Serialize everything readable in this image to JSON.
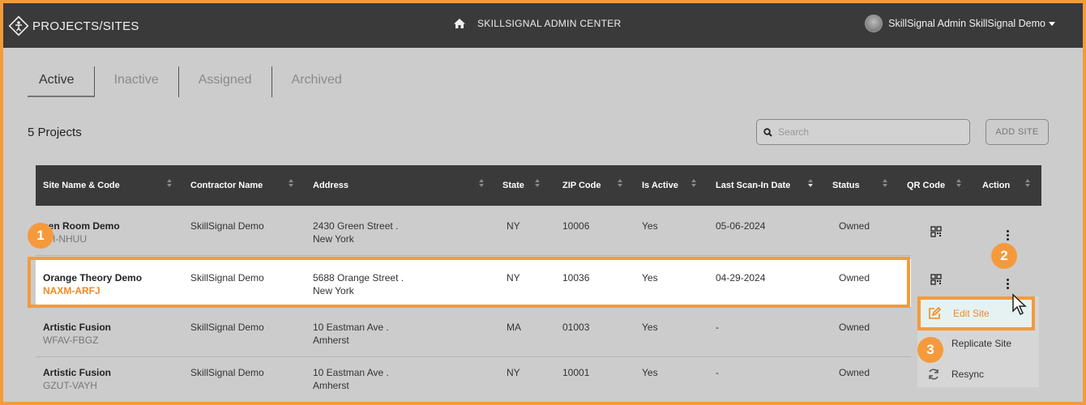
{
  "header": {
    "brand": "PROJECTS/SITES",
    "center_title": "SKILLSIGNAL ADMIN CENTER",
    "user_name": "SkillSignal Admin SkillSignal Demo"
  },
  "tabs": [
    {
      "label": "Active",
      "active": true
    },
    {
      "label": "Inactive",
      "active": false
    },
    {
      "label": "Assigned",
      "active": false
    },
    {
      "label": "Archived",
      "active": false
    }
  ],
  "project_count": "5 Projects",
  "search": {
    "placeholder": "Search"
  },
  "add_site_label": "ADD SITE",
  "columns": [
    "Site Name & Code",
    "Contractor Name",
    "Address",
    "State",
    "ZIP Code",
    "Is Active",
    "Last Scan-In Date",
    "Status",
    "QR Code",
    "Action"
  ],
  "rows": [
    {
      "name": "een Room Demo",
      "code": "7H-NHUU",
      "contractor": "SkillSignal Demo",
      "address1": "2430 Green Street .",
      "address2": "New York",
      "state": "NY",
      "zip": "10006",
      "active": "Yes",
      "last_scan": "05-06-2024",
      "status": "Owned"
    },
    {
      "name": "Orange Theory Demo",
      "code": "NAXM-ARFJ",
      "contractor": "SkillSignal Demo",
      "address1": "5688 Orange Street .",
      "address2": "New York",
      "state": "NY",
      "zip": "10036",
      "active": "Yes",
      "last_scan": "04-29-2024",
      "status": "Owned"
    },
    {
      "name": "Artistic Fusion",
      "code": "WFAV-FBGZ",
      "contractor": "SkillSignal Demo",
      "address1": "10 Eastman Ave .",
      "address2": "Amherst",
      "state": "MA",
      "zip": "01003",
      "active": "Yes",
      "last_scan": "-",
      "status": "Owned"
    },
    {
      "name": "Artistic Fusion",
      "code": "GZUT-VAYH",
      "contractor": "SkillSignal Demo",
      "address1": "10 Eastman Ave .",
      "address2": "Amherst",
      "state": "NY",
      "zip": "10001",
      "active": "Yes",
      "last_scan": "-",
      "status": "Owned"
    }
  ],
  "action_menu": {
    "edit": "Edit Site",
    "replicate": "Replicate Site",
    "resync": "Resync"
  },
  "badges": [
    "1",
    "2",
    "3"
  ],
  "colors": {
    "accent": "#f59a3c",
    "header_bg": "#3a3a3a",
    "page_bg": "#cccccc",
    "code_highlight": "#f08a23"
  }
}
